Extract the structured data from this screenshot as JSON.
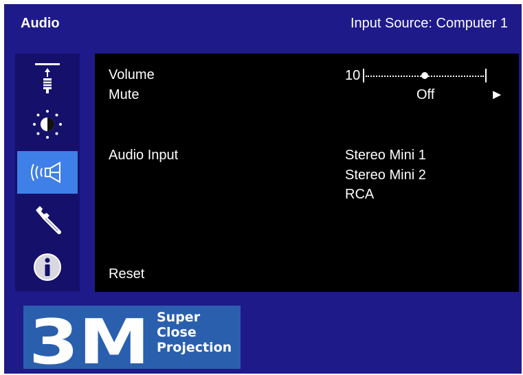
{
  "header": {
    "title": "Audio",
    "input_source": "Input Source: Computer 1"
  },
  "sidebar": {
    "items": [
      {
        "name": "position-icon",
        "selected": false
      },
      {
        "name": "brightness-icon",
        "selected": false
      },
      {
        "name": "audio-icon",
        "selected": true
      },
      {
        "name": "wrench-icon",
        "selected": false
      },
      {
        "name": "info-icon",
        "selected": false
      }
    ]
  },
  "menu": {
    "volume": {
      "label": "Volume",
      "value": "10",
      "level_fraction": 0.5
    },
    "mute": {
      "label": "Mute",
      "value": "Off",
      "arrow": "►"
    },
    "audio_input": {
      "label": "Audio Input",
      "options": [
        "Stereo Mini 1",
        "Stereo Mini 2",
        "RCA"
      ]
    },
    "reset": {
      "label": "Reset"
    }
  },
  "logo": {
    "mark": "3M",
    "tagline": [
      "Super",
      "Close",
      "Projection"
    ]
  },
  "colors": {
    "background": "#1f1a8a",
    "panel": "#000000",
    "selected": "#3f7fe8",
    "logo_bg": "#2a5fae"
  }
}
